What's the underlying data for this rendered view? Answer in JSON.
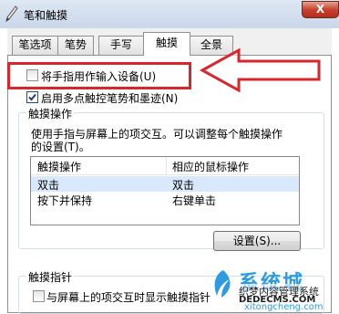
{
  "window": {
    "title": "笔和触摸",
    "close_label": "X"
  },
  "tabs": [
    {
      "label": "笔选项"
    },
    {
      "label": "笔势"
    },
    {
      "label": "手写"
    },
    {
      "label": "触摸",
      "active": true
    },
    {
      "label": "全景"
    }
  ],
  "touch_input": {
    "label": "将手指用作输入设备(U)",
    "checked": false
  },
  "multitouch": {
    "label": "启用多点触控笔势和墨迹(N)",
    "checked": true
  },
  "touch_actions": {
    "title": "触摸操作",
    "description_line1": "使用手指与屏幕上的项交互。可以调整每个触摸操作",
    "description_line2": "的设置(T)。",
    "columns": [
      "触摸操作",
      "相应的鼠标操作"
    ],
    "rows": [
      {
        "action": "双击",
        "mouse": "双击",
        "selected": true
      },
      {
        "action": "按下并保持",
        "mouse": "右键单击",
        "selected": false
      }
    ],
    "settings_button": "设置(S)..."
  },
  "touch_pointer": {
    "title": "触摸指针",
    "option_label": "与屏幕上的项交互时显示触摸指针",
    "checked": false
  },
  "watermark": {
    "brand": "系统城",
    "sub1": "织梦内容管理系统",
    "sub2": "DEDECMS.COM",
    "sub3": "xitongcheng.com"
  },
  "colors": {
    "annotation_red": "#d8262e",
    "selection": "#d9e8fb",
    "titlebar": "#dfe8f3"
  }
}
